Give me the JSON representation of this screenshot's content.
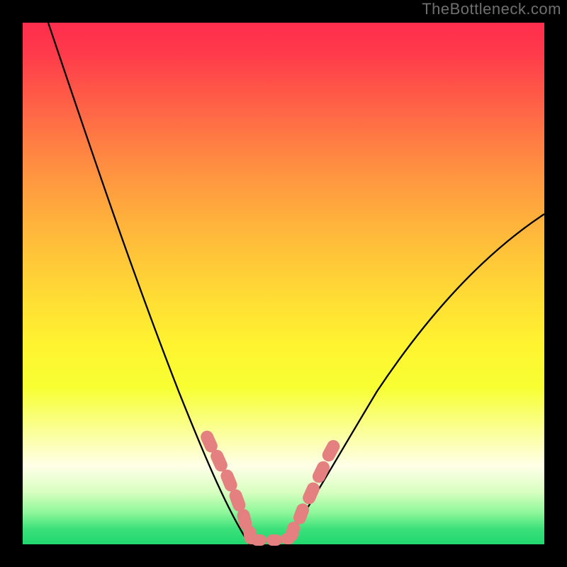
{
  "watermark": "TheBottleneck.com",
  "colors": {
    "background": "#000000",
    "curve": "#000000",
    "blob": "#e48080"
  },
  "chart_data": {
    "type": "line",
    "title": "",
    "xlabel": "",
    "ylabel": "",
    "xlim": [
      0,
      100
    ],
    "ylim": [
      0,
      100
    ],
    "grid": false,
    "legend": false,
    "series": [
      {
        "name": "left-curve",
        "x": [
          5,
          10,
          15,
          20,
          25,
          30,
          33,
          36,
          38,
          40,
          42,
          44
        ],
        "y": [
          100,
          86,
          72,
          58,
          44,
          30,
          20,
          12,
          6,
          3,
          1,
          0
        ]
      },
      {
        "name": "right-curve",
        "x": [
          50,
          52,
          55,
          60,
          65,
          70,
          75,
          80,
          85,
          90,
          95,
          100
        ],
        "y": [
          0,
          2,
          6,
          14,
          22,
          29,
          36,
          42,
          48,
          53,
          58,
          63
        ]
      }
    ],
    "annotations": [
      {
        "name": "left-blob-cluster",
        "x_range": [
          35,
          44
        ],
        "y_range": [
          0,
          22
        ]
      },
      {
        "name": "right-blob-cluster",
        "x_range": [
          50,
          57
        ],
        "y_range": [
          0,
          22
        ]
      }
    ]
  }
}
